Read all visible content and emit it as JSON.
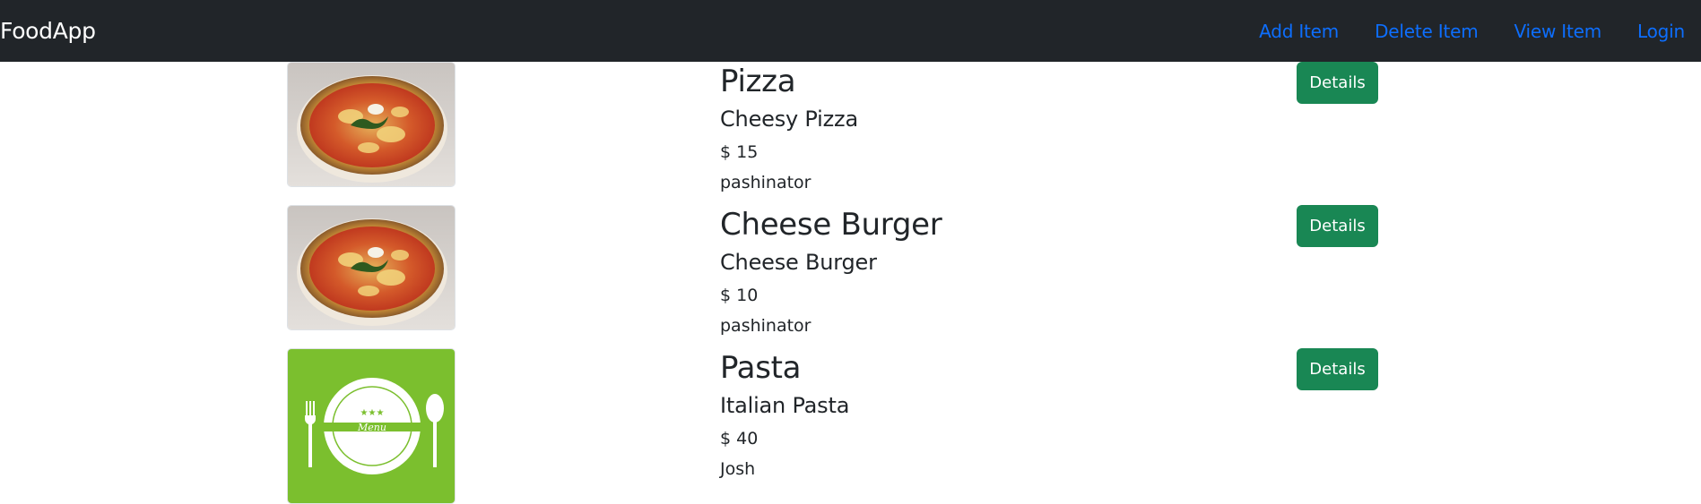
{
  "navbar": {
    "brand": "FoodApp",
    "links": [
      {
        "label": "Add Item"
      },
      {
        "label": "Delete Item"
      },
      {
        "label": "View Item"
      },
      {
        "label": "Login"
      }
    ]
  },
  "colors": {
    "navbar_bg": "#212529",
    "link": "#0d6efd",
    "button": "#198754"
  },
  "items": [
    {
      "title": "Pizza",
      "description": "Cheesy Pizza",
      "price": "$ 15",
      "author": "pashinator",
      "image": "pizza-image",
      "button": "Details"
    },
    {
      "title": "Cheese Burger",
      "description": "Cheese Burger",
      "price": "$ 10",
      "author": "pashinator",
      "image": "pizza-image",
      "button": "Details"
    },
    {
      "title": "Pasta",
      "description": "Italian Pasta",
      "price": "$ 40",
      "author": "Josh",
      "image": "menu-plate-image",
      "button": "Details"
    }
  ]
}
